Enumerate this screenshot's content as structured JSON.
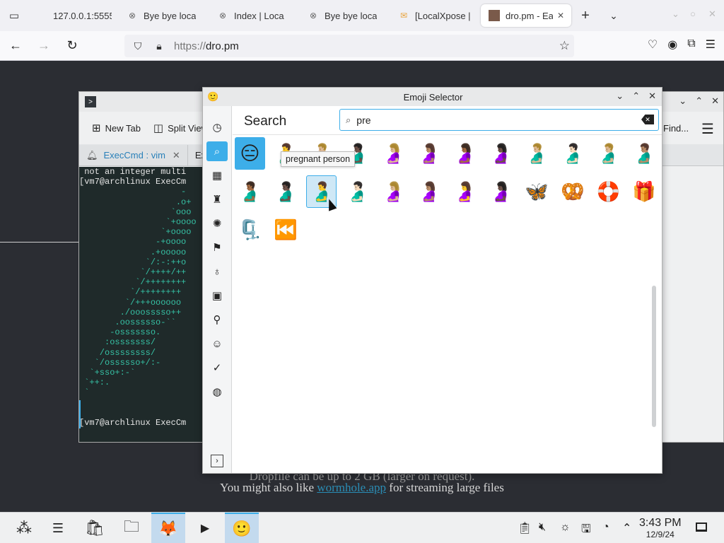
{
  "browser": {
    "tabs": [
      {
        "label": "127.0.0.1:5555/",
        "icon": "blank-page-icon"
      },
      {
        "label": "Bye bye loca",
        "icon": "x-circle-icon"
      },
      {
        "label": "Index | Loca",
        "icon": "x-circle-icon"
      },
      {
        "label": "Bye bye loca",
        "icon": "x-circle-icon"
      },
      {
        "label": "[LocalXpose |",
        "icon": "envelope-icon"
      },
      {
        "label": "dro.pm - Ea",
        "icon": "dro-favicon",
        "active": true
      }
    ],
    "url": {
      "protocol": "https://",
      "host": "dro.pm"
    }
  },
  "page": {
    "line1": "Dropfile can be up to 2 GB (larger on request).",
    "line2_prefix": "You might also like ",
    "line2_link": "wormhole.app",
    "line2_suffix": " for streaming large files"
  },
  "konsole": {
    "toolbar": {
      "new_tab": "New Tab",
      "split_view": "Split View",
      "find": "Find..."
    },
    "tabs": [
      {
        "label": "ExecCmd : vim"
      },
      {
        "label": "Ex"
      }
    ],
    "terminal_lines": [
      " not an integer multi",
      "[vm7@archlinux ExecCm",
      "                    -",
      "                   .o+",
      "                  `ooo",
      "                 `+oooo",
      "                `+oooo",
      "               -+oooo",
      "              .+ooooo",
      "             `/:-:++o",
      "            `/++++/++",
      "           `/++++++++",
      "          `/++++++++",
      "         `/+++oooooo",
      "        ./ooosssso++",
      "       .oossssso-``",
      "      -osssssso.",
      "     :osssssss/",
      "    /ossssssss/",
      "   `/ossssso+/:-",
      "  `+sso+:-`",
      " `++:.",
      " `",
      "",
      "",
      "[vm7@archlinux ExecCm"
    ]
  },
  "emoji_selector": {
    "title": "Emoji Selector",
    "header": "Search",
    "search_value": "pre",
    "tooltip": "pregnant person",
    "categories": [
      "recent-icon",
      "search-icon",
      "symbols-grid-icon",
      "trophy-icon",
      "food-icon",
      "flag-icon",
      "ice-cream-icon",
      "objects-grid-icon",
      "person-icon",
      "smiley-icon",
      "checkmark-icon",
      "globe-icon"
    ],
    "emojis": [
      "😑",
      "🫃",
      "🫃🏼",
      "🫃🏿",
      "🤰🏼",
      "🤰🏽",
      "🤰🏾",
      "🤰🏿",
      "🫃🏼",
      "🫃🏻",
      "🫃🏼",
      "🫃🏽",
      "🫃🏾",
      "🫃🏿",
      "🫃",
      "🫃🏻",
      "🤰🏼",
      "🤰🏽",
      "🤰",
      "🤰🏿",
      "🦋",
      "🥨",
      "🛟",
      "🎁",
      "🗜️",
      "⏮️"
    ]
  },
  "taskbar": {
    "time": "3:43 PM",
    "date": "12/9/24"
  },
  "colors": {
    "accent": "#3daee9",
    "terminal_bg": "#1f2a2a",
    "terminal_art": "#36c2a5",
    "page_bg": "#2b2d33"
  }
}
